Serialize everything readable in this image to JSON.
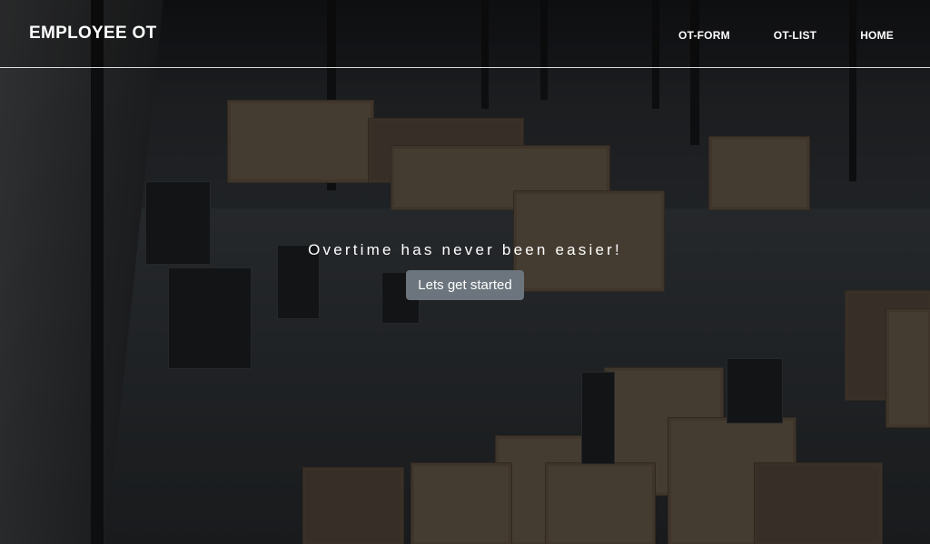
{
  "navbar": {
    "brand": "EMPLOYEE OT",
    "links": [
      {
        "label": "OT-FORM"
      },
      {
        "label": "OT-LIST"
      },
      {
        "label": "HOME"
      }
    ]
  },
  "hero": {
    "tagline": "Overtime has never been easier!",
    "cta_label": "Lets get started"
  },
  "colors": {
    "button_bg": "#6c757d",
    "text": "#ffffff",
    "navbar_border": "#ffffff"
  }
}
